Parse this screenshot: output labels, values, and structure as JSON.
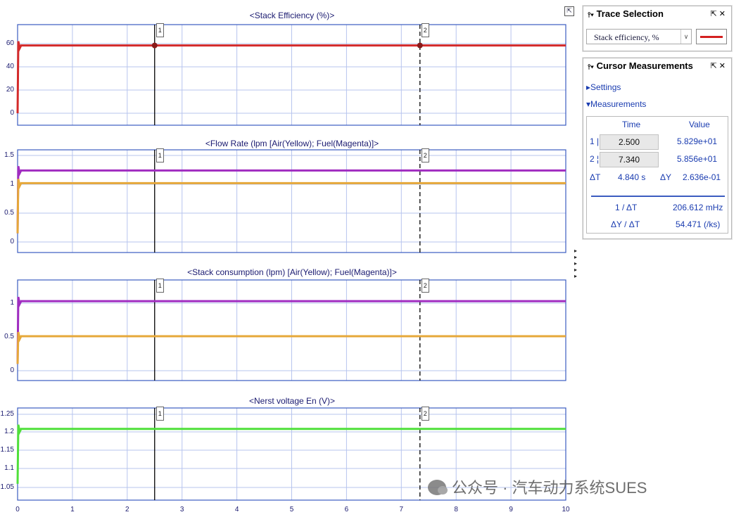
{
  "plots": [
    {
      "title": "<Stack Efficiency (%)>",
      "yticks": [
        "60",
        "40",
        "20",
        "0"
      ]
    },
    {
      "title": "<Flow Rate (lpm [Air(Yellow); Fuel(Magenta)]>",
      "yticks": [
        "1.5",
        "1",
        "0.5",
        "0"
      ]
    },
    {
      "title": "<Stack consumption (lpm) [Air(Yellow); Fuel(Magenta)]>",
      "yticks": [
        "1",
        "0.5",
        "0"
      ]
    },
    {
      "title": "<Nerst voltage En (V)>",
      "yticks": [
        "1.25",
        "1.2",
        "1.15",
        "1.1",
        "1.05"
      ]
    }
  ],
  "xticks": [
    "0",
    "1",
    "2",
    "3",
    "4",
    "5",
    "6",
    "7",
    "8",
    "9",
    "10"
  ],
  "cursor_labels": [
    "1",
    "2"
  ],
  "cursor_times": [
    2.5,
    7.34
  ],
  "series_colors": {
    "efficiency": "#d42a2a",
    "fuel": "#a02cc0",
    "air": "#e6a83a",
    "voltage": "#4fe03a",
    "grid": "#b7c4ee",
    "axis": "#3b5cc0"
  },
  "trace_selection": {
    "title": "Trace Selection",
    "selected": "Stack efficiency, %"
  },
  "cursor_measurements": {
    "title": "Cursor Measurements",
    "settings_label": "Settings",
    "measurements_label": "Measurements",
    "time_header": "Time",
    "value_header": "Value",
    "row1_label": "1 |",
    "row1_time": "2.500",
    "row1_value": "5.829e+01",
    "row2_label": "2 ¦",
    "row2_time": "7.340",
    "row2_value": "5.856e+01",
    "dt_label": "ΔT",
    "dt_value": "4.840 s",
    "dy_label": "ΔY",
    "dy_value": "2.636e-01",
    "inv_dt_label": "1 / ΔT",
    "inv_dt_value": "206.612 mHz",
    "dy_dt_label": "ΔY / ΔT",
    "dy_dt_value": "54.471 (/ks)"
  },
  "watermark": "公众号 · 汽车动力系统SUES"
}
